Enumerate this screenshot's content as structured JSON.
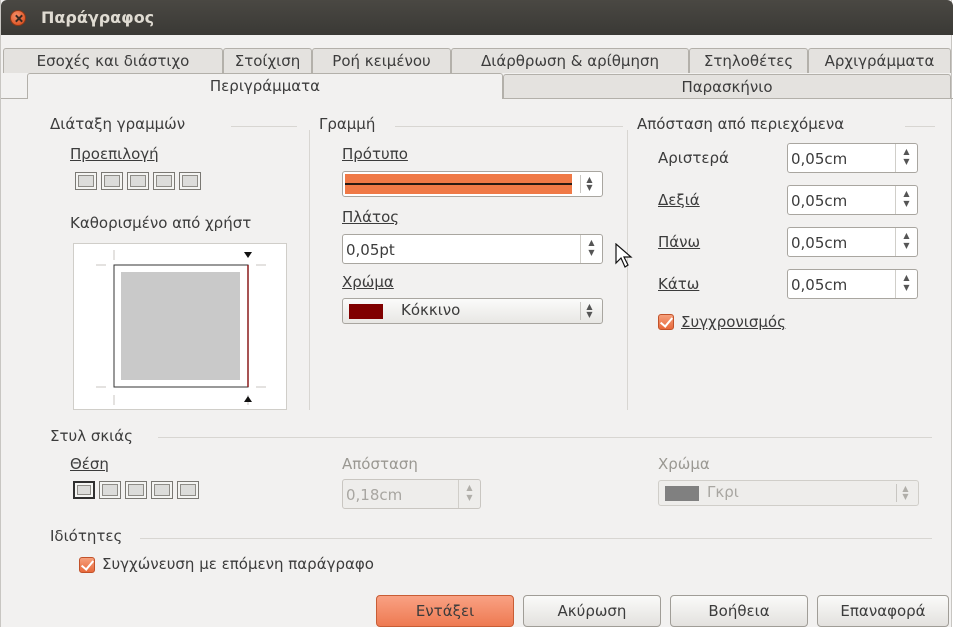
{
  "window": {
    "title": "Παράγραφος"
  },
  "tabs_row1": [
    "Εσοχές και διάστιχο",
    "Στοίχιση",
    "Ροή κειμένου",
    "Διάρθρωση & αρίθμηση",
    "Στηλοθέτες",
    "Αρχιγράμματα"
  ],
  "tabs_row2": [
    "Περιγράμματα",
    "Παρασκήνιο"
  ],
  "active_tab": "Περιγράμματα",
  "line_arrangement": {
    "title": "Διάταξη γραμμών",
    "default_label": "Προεπιλογή",
    "user_defined_label": "Καθορισμένο από χρήστ"
  },
  "line": {
    "title": "Γραμμή",
    "style_label": "Πρότυπο",
    "width_label": "Πλάτος",
    "width_value": "0,05pt",
    "color_label": "Χρώμα",
    "color_value": "Κόκκινο",
    "color_hex": "#800000"
  },
  "spacing": {
    "title": "Απόσταση από περιεχόμενα",
    "left_label": "Αριστερά",
    "left_value": "0,05cm",
    "right_label": "Δεξιά",
    "right_value": "0,05cm",
    "top_label": "Πάνω",
    "top_value": "0,05cm",
    "bottom_label": "Κάτω",
    "bottom_value": "0,05cm",
    "sync_label": "Συγχρονισμός",
    "sync_checked": true
  },
  "shadow": {
    "title": "Στυλ σκιάς",
    "position_label": "Θέση",
    "distance_label": "Απόσταση",
    "distance_value": "0,18cm",
    "color_label": "Χρώμα",
    "color_value": "Γκρι",
    "color_hex": "#808080"
  },
  "properties": {
    "title": "Ιδιότητες",
    "merge_label": "Συγχώνευση με επόμενη παράγραφο",
    "merge_checked": true
  },
  "buttons": {
    "ok": "Εντάξει",
    "cancel": "Ακύρωση",
    "help": "Βοήθεια",
    "reset": "Επαναφορά"
  },
  "colors": {
    "accent": "#ee7a52",
    "titlebar": "#3c3b37",
    "line_preview": "#f07946"
  }
}
